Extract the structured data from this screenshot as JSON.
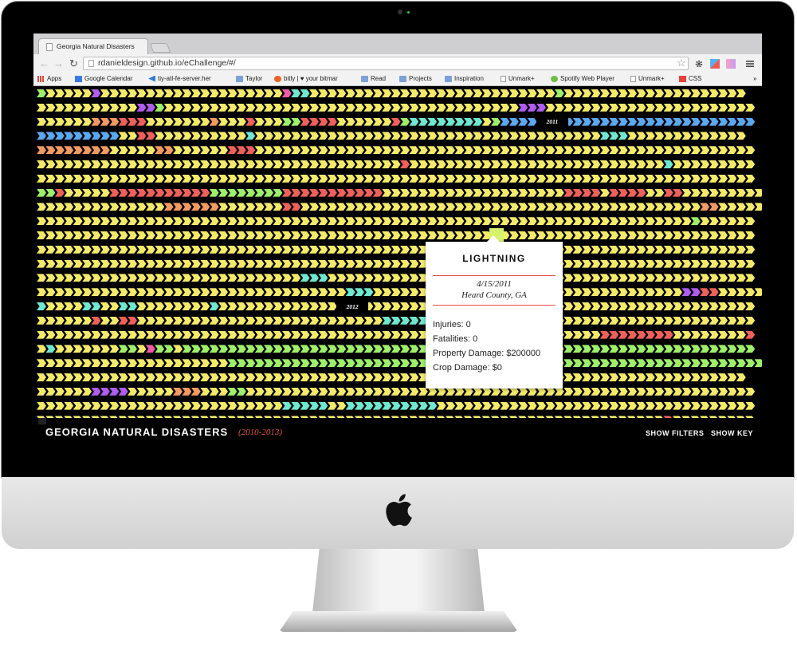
{
  "browser": {
    "tab_title": "Georgia Natural Disasters",
    "url": "rdanieldesign.github.io/eChallenge/#/",
    "nav": {
      "back": "←",
      "forward": "→",
      "reload": "↻"
    },
    "star_icon": "☆",
    "bookmarks": [
      {
        "label": "Apps",
        "icon": "apps-grid-icon"
      },
      {
        "label": "Google Calendar",
        "icon": "calendar-icon"
      },
      {
        "label": "tiy-atl-fe-server.her",
        "icon": "code-icon"
      },
      {
        "label": "Taylor",
        "icon": "folder-icon"
      },
      {
        "label": "bitly | ♥ your bitmar",
        "icon": "bitly-icon"
      },
      {
        "label": "Read",
        "icon": "folder-icon"
      },
      {
        "label": "Projects",
        "icon": "folder-icon"
      },
      {
        "label": "Inspiration",
        "icon": "folder-icon"
      },
      {
        "label": "Unmark+",
        "icon": "page-icon"
      },
      {
        "label": "Spotify Web Player",
        "icon": "spotify-icon"
      },
      {
        "label": "Unmark+",
        "icon": "page-icon"
      },
      {
        "label": "CSS",
        "icon": "css-icon"
      }
    ],
    "bookmarks_overflow": "»"
  },
  "viz": {
    "palette": {
      "Y": "#f4ea6a",
      "G": "#9ef06a",
      "L": "#d6f26a",
      "C": "#6ee8d0",
      "B": "#5aa8f0",
      "P": "#b05cf0",
      "K": "#f05aa8",
      "R": "#f0605a",
      "O": "#f29a60"
    },
    "rows": [
      "GYYYYYPYYYYYYYYYYYYYYYYYYYYKCCYYYYYYYYYYYYYYYYYYYYYYYYYYYGYYYYYYYYYYYYYYYYYYYY",
      "YYYYYYYYYYYPPGYYYYYYYYYYYYYYYYYYYYYYYYYYYYYYYYYYYYYYYPPPYYYYYYYYYYYYYYYYYYYYYYY",
      "YYYYYYOOORRRYYYYYYYOYYYRYYYGGRRRRYYYYYYRGCCCCCCCCYGBBBBBBBBBBBBBBBBBBBBBBBBBBBB",
      "BBBBBBBBBYYRRYYYYYYYYYYCYYYYYYYYYYYYYYYYYYYYYYYYYYYYYYYYYYYYYYCCCYYYYYYYYYYYYY",
      "OOOOOOOOYYYYYOOYYYYYYRRRYYYYYYYYYYYYYYYYYYYYYYYYYYYYYYYYYYYYYYYYYYYYYYYYYYYYYYY",
      "YYYYYYYYYYYYYYYYYYYYYYYYYYYYYYYYYYYYYYYYRYYYYYYYYYYYYYYYYYYYYYYYYYYYYCYYYYYYYYY",
      "YYYYYYYYYYYYYYYYYYYYYYYYYYYYYYYYYYYYYYYYYYYYYYYYYYYYYYYYYYYYYYYYYYYYYYYYYYYYYYY",
      "GGRYYYYYRRRRRRRRRRRGGGGGGGGRRRRRRRRRRRYYYYYYYYYYYYYYYYYYYYRRRRYRRRRYYRRYYYYYYYYY",
      "YYYYYYYYYYYYYYOOOOOOYYYYYYYRRYYYYYYYYYYYYYYYYYYYYYYYYYYYYYYYYYYYYYYYYYYYYOOYYYYY",
      "YYYYYYYYYYYYYYYYYYYYYYYYYYYYYYYYYYYYYYYYYYYYYYYYYYYYYYYYYYYYYYYYYYYYYYYYGYYYYYY",
      "YYYYYYYYYYYYYYYYYYYYYYYYYYYYYYYYYYYYYYYYYYYYYYYYYYYYYYYYYYYYYYYYYYYYYYYYYYYYYYY",
      "YYYYYYYYYYYYYYYYYYYYYYYYYYYYYYYYYYYYYYYYYYYYYYYYYYYYYYYYYYYYYYYYYYYYYYYYYYYYYYY",
      "YYYYYYYYYYYYYYYYYYYYYYYYYYYYYYYYYYYYYYYYYYYYYYYYYYYYYYYYYYYYYYYYYYYYYYYYYYYYYYY",
      "YYYYYYYYYYYYYYYYYYYYYYYYYYYYYCCCYYYYYYYYYYYYYYYYYYYYYYYYYYYYYYYYYYYYYYYYYYYYYYY",
      "YYYYYYYYYYYYYYYYYYYYYYYYYYYYYYYYYYCCCYYYYYYYYYYYYYYYYYYYYYYYYYYYYYYYYYYPPRRYYYYY",
      "CYYYYCCYYCCYYYYYYYYCYYYYYYYYYYYYYYYYYYYYYYYYYYYYYYYYYYYYYYYYYYYYYYYYYYYYYYYYYYY",
      "YYYYYYRYYRRYYYYYYYYYYYYYYYYYYYYYYYYYYYCCCCCCCYYYYYYYYYYYYYYYYYYYYYYYYYYYYYYYYYY",
      "YYYYYYYYYYYYYYYYYYYYYYYYYYYYYYYYYYYYYYYYYYYYYYYYYYYYYYYYYYYYYYRRRRRRRRYYYYYYYYR",
      "YCYYYYYYYGGYKGGYGGGGGGGGGGGGGGGGGGGGGGGGGGGGGGGGGGGGGGGGGGGGGGGGGGGGGGGGGGGGGGG",
      "YYYYYYYYYYYYYYYYYYYYYGGGGGGGGGGGGGGGGGGGGGGGGGGGGGGGGGGGGGGGGGGGGGGGGGGGGGGGGGGG",
      "YYYYYYYYYYYYYYYYYYYYYYYYYYYYYYYYYYYYYYYYYYYYYGYYYYYYYYYYYYYYYYYYYYYYYYYYYYYYYY",
      "YYYYYYPPPPYYYYYOOOYYYGGYYYYYYYYYYYYYYYYYYYYYYYYYYYYYYYYYYYYYYYYYYYYYYYYYYYYYYYY",
      "YYYYYYYYYYYYYYYYYYYYYYYYYYYCCCCCYYCCCCCCCCCCYYYYYYYYYYYYYYYYYYYYYYYYYYYYYYYYYYY",
      "YYYYYYYYYYYYYYYYYYYYYYYYYYYYYYYYYYYYYYYYYYYYYYYYYYYYYYYYYYYYYYYYYYYYYRYYYYYYYYY"
    ],
    "year_labels": [
      {
        "row": 2,
        "col": 55,
        "text": "2011"
      },
      {
        "row": 15,
        "col": 33,
        "text": "2012"
      }
    ]
  },
  "tooltip": {
    "title": "LIGHTNING",
    "date": "4/15/2011",
    "location": "Heard County, GA",
    "injuries": "Injuries: 0",
    "fatalities": "Fatalities: 0",
    "property_damage": "Property Damage: $200000",
    "crop_damage": "Crop Damage: $0"
  },
  "footer": {
    "title": "GEORGIA NATURAL DISASTERS",
    "years": "(2010-2013)",
    "show_filters": "SHOW FILTERS",
    "show_key": "SHOW KEY"
  }
}
